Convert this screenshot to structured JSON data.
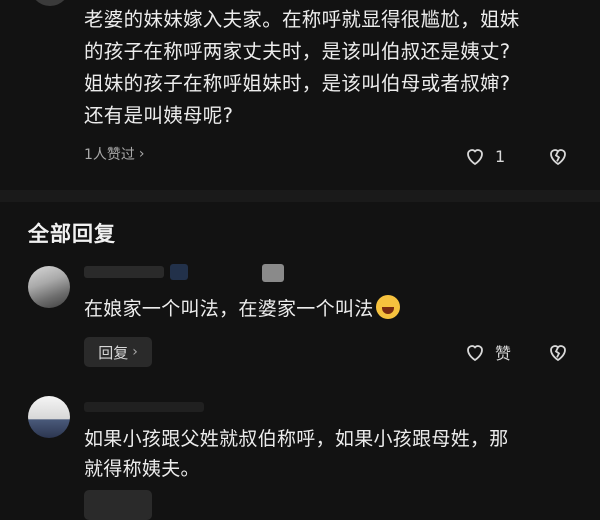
{
  "post": {
    "lines": [
      "老婆的妹妹嫁入夫家。在称呼就显得很尴尬，姐妹",
      "的孩子在称呼两家丈夫时，是该叫伯叔还是姨丈?",
      "姐妹的孩子在称呼姐妹时，是该叫伯母或者叔婶?",
      "还有是叫姨母呢?"
    ],
    "liked_by": "1人赞过",
    "like_count": "1"
  },
  "section_title": "全部回复",
  "comments": [
    {
      "text": "在娘家一个叫法，在婆家一个叫法",
      "reply_label": "回复",
      "like_label": "赞"
    },
    {
      "lines": [
        "如果小孩跟父姓就叔伯称呼，如果小孩跟母姓，那",
        "就得称姨夫。"
      ]
    }
  ],
  "icons": {
    "like": "heart-icon",
    "dislike": "broken-heart-icon",
    "chevron": "chevron-right-icon",
    "emoji": "laughing-crying-emoji-icon"
  },
  "colors": {
    "background": "#121212",
    "text": "#ececec",
    "muted": "#a9a9a9",
    "button_bg": "#2a2a2a"
  }
}
